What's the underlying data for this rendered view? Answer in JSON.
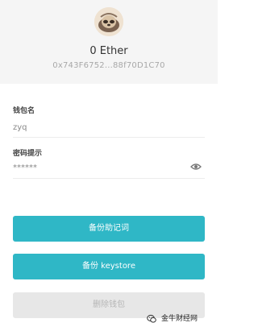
{
  "wallet": {
    "balance": "0 Ether",
    "address": "0x743F6752...88f70D1C70"
  },
  "form": {
    "name_label": "钱包名",
    "name_value": "zyq",
    "hint_label": "密码提示",
    "hint_value": "******"
  },
  "actions": {
    "backup_mnemonic": "备份助记词",
    "backup_keystore": "备份 keystore",
    "delete_wallet": "删除钱包"
  },
  "watermark": {
    "text": "金牛财经网"
  },
  "colors": {
    "accent": "#2fb7c6",
    "disabled": "#e7e7e7"
  }
}
